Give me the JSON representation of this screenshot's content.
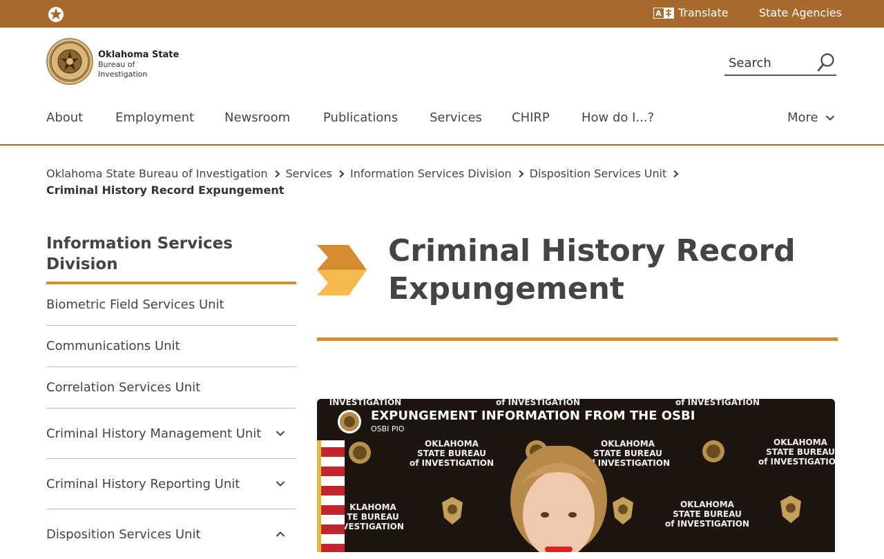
{
  "topbar": {
    "translate_label": "Translate",
    "agencies_label": "State Agencies"
  },
  "brand": {
    "line1": "Oklahoma State",
    "line2": "Bureau of",
    "line3": "Investigation"
  },
  "search": {
    "placeholder": "Search"
  },
  "nav": {
    "items": [
      "About",
      "Employment",
      "Newsroom",
      "Publications",
      "Services",
      "CHIRP",
      "How do I...?"
    ],
    "more_label": "More"
  },
  "breadcrumb": {
    "items": [
      "Oklahoma State Bureau of Investigation",
      "Services",
      "Information Services Division",
      "Disposition Services Unit"
    ],
    "current": "Criminal History Record Expungement"
  },
  "sidebar": {
    "title": "Information Services Division",
    "items": [
      {
        "label": "Biometric Field Services Unit"
      },
      {
        "label": "Communications Unit"
      },
      {
        "label": "Correlation Services Unit"
      },
      {
        "label": "Criminal History Management Unit"
      },
      {
        "label": "Criminal History Reporting Unit"
      },
      {
        "label": "Disposition Services Unit"
      }
    ]
  },
  "page": {
    "title": "Criminal History Record Expungement"
  },
  "video": {
    "title": "EXPUNGEMENT INFORMATION FROM THE OSBI",
    "channel": "OSBI PIO",
    "backdrop": {
      "line1": "OKLAHOMA",
      "line2": "STATE BUREAU",
      "line3": "of INVESTIGATION",
      "top_line": "INVESTIGATION",
      "top_line_short": "of INVESTIGATION",
      "left_l1": "KLAHOMA",
      "left_l2": "TE BUREAU",
      "left_l3": "VESTIGATION"
    }
  },
  "colors": {
    "accent": "#a86a2c",
    "orange": "#d58b30",
    "gold": "#f3b44a"
  }
}
